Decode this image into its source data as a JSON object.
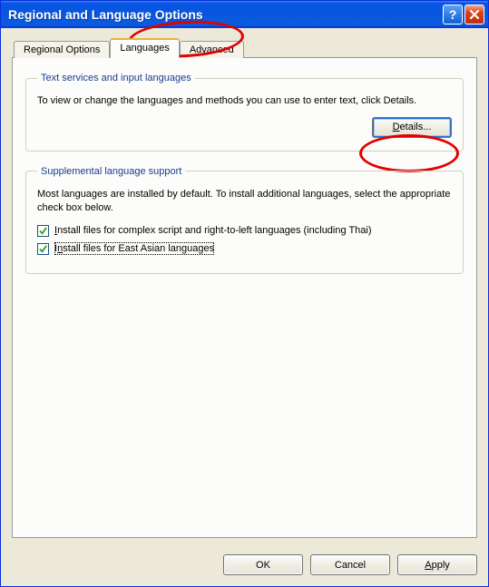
{
  "window": {
    "title": "Regional and Language Options"
  },
  "tabs": [
    {
      "label": "Regional Options",
      "active": false
    },
    {
      "label": "Languages",
      "active": true
    },
    {
      "label": "Advanced",
      "active": false
    }
  ],
  "group1": {
    "legend": "Text services and input languages",
    "desc": "To view or change the languages and methods you can use to enter text, click Details.",
    "details_btn": "Details..."
  },
  "group2": {
    "legend": "Supplemental language support",
    "desc": "Most languages are installed by default. To install additional languages, select the appropriate check box below.",
    "cb1": {
      "checked": true,
      "label": "Install files for complex script and right-to-left languages (including Thai)"
    },
    "cb2": {
      "checked": true,
      "label": "Install files for East Asian languages"
    }
  },
  "buttons": {
    "ok": "OK",
    "cancel": "Cancel",
    "apply": "Apply"
  },
  "annotations": {
    "tab_circle": true,
    "details_circle": true
  }
}
